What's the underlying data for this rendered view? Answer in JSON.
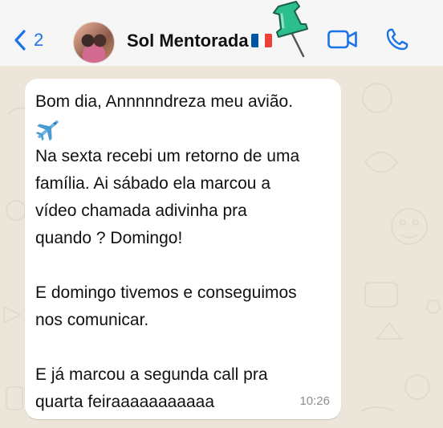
{
  "header": {
    "back_count": "2",
    "contact_name": "Sol Mentorada",
    "flag_colors": [
      "#0055a4",
      "#ffffff",
      "#ef4135"
    ],
    "icons": [
      "back-chevron-icon",
      "pushpin-icon",
      "video-call-icon",
      "phone-call-icon"
    ],
    "accent_color": "#1a73e8"
  },
  "message": {
    "lines": [
      "Bom dia, Annnnndreza meu avião.",
      "Na sexta recebi um retorno de uma",
      "família. Ai sábado ela marcou a",
      "vídeo chamada adivinha pra",
      "quando ? Domingo!",
      "E domingo tivemos e conseguimos",
      "nos comunicar.",
      "E já marcou a segunda call pra",
      "quarta feiraaaaaaaaaaa"
    ],
    "emoji": "airplane-icon",
    "time": "10:26"
  }
}
